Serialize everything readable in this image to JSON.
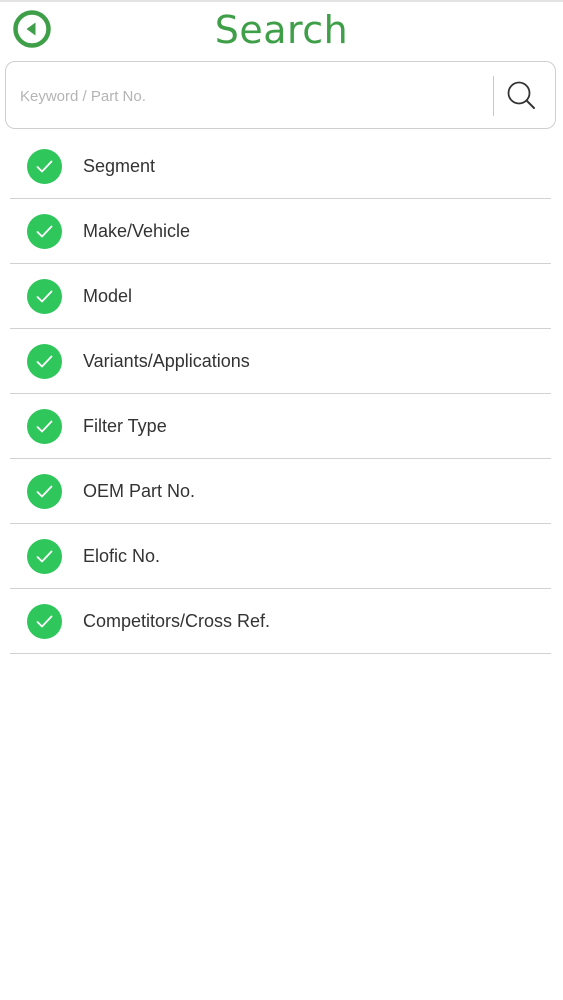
{
  "header": {
    "title": "Search",
    "back_icon": "back-arrow-circle-icon",
    "accent_color": "#3f9f48"
  },
  "search": {
    "placeholder": "Keyword / Part No.",
    "value": "",
    "button_icon": "search-icon"
  },
  "filters": {
    "check_color": "#2fc65c",
    "items": [
      {
        "label": "Segment",
        "checked": true
      },
      {
        "label": "Make/Vehicle",
        "checked": true
      },
      {
        "label": "Model",
        "checked": true
      },
      {
        "label": "Variants/Applications",
        "checked": true
      },
      {
        "label": "Filter Type",
        "checked": true
      },
      {
        "label": "OEM Part No.",
        "checked": true
      },
      {
        "label": "Elofic No.",
        "checked": true
      },
      {
        "label": "Competitors/Cross Ref.",
        "checked": true
      }
    ]
  }
}
